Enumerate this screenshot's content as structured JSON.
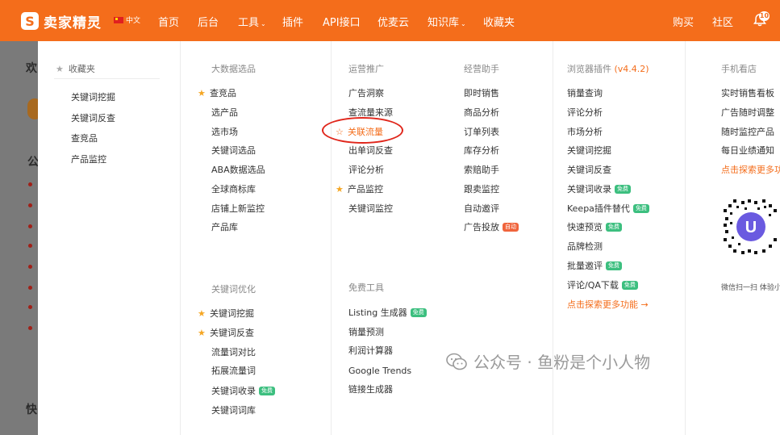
{
  "topbar": {
    "logo_text": "卖家精灵",
    "lang_label": "中文",
    "nav": [
      {
        "label": "首页",
        "caret": false
      },
      {
        "label": "后台",
        "caret": false
      },
      {
        "label": "工具",
        "caret": true
      },
      {
        "label": "插件",
        "caret": false
      },
      {
        "label": "API接口",
        "caret": false
      },
      {
        "label": "优麦云",
        "caret": false
      },
      {
        "label": "知识库",
        "caret": true
      },
      {
        "label": "收藏夹",
        "caret": false
      }
    ],
    "right": [
      {
        "label": "购买"
      },
      {
        "label": "社区"
      }
    ],
    "notification_count": "10",
    "accent": "#f46d1b"
  },
  "background": {
    "fragments": [
      "欢",
      "公",
      "快"
    ]
  },
  "panel": {
    "favorites": {
      "title": "收藏夹",
      "items": [
        "关键词挖掘",
        "关键词反查",
        "查竞品",
        "产品监控"
      ]
    },
    "big_data": {
      "title": "大数据选品",
      "items": [
        {
          "label": "查竞品",
          "starred": true
        },
        {
          "label": "选产品"
        },
        {
          "label": "选市场"
        },
        {
          "label": "关键词选品"
        },
        {
          "label": "ABA数据选品"
        },
        {
          "label": "全球商标库"
        },
        {
          "label": "店铺上新监控"
        },
        {
          "label": "产品库"
        }
      ]
    },
    "keyword_opt": {
      "title": "关键词优化",
      "items": [
        {
          "label": "关键词挖掘",
          "starred": true
        },
        {
          "label": "关键词反查",
          "starred": true
        },
        {
          "label": "流量词对比"
        },
        {
          "label": "拓展流量词"
        },
        {
          "label": "关键词收录",
          "badge": "免费"
        },
        {
          "label": "关键词词库"
        }
      ]
    },
    "ops": {
      "title": "运营推广",
      "items": [
        {
          "label": "广告洞察"
        },
        {
          "label": "查流量来源"
        },
        {
          "label": "关联流量",
          "outline_star": true
        },
        {
          "label": "出单词反查"
        },
        {
          "label": "评论分析"
        },
        {
          "label": "产品监控",
          "starred": true
        },
        {
          "label": "关键词监控"
        }
      ]
    },
    "free_tools": {
      "title": "免费工具",
      "items": [
        {
          "label": "Listing 生成器",
          "badge": "免费"
        },
        {
          "label": "销量预测"
        },
        {
          "label": "利润计算器"
        },
        {
          "label": "Google Trends"
        },
        {
          "label": "链接生成器"
        }
      ]
    },
    "assistant": {
      "title": "经营助手",
      "items": [
        {
          "label": "即时销售"
        },
        {
          "label": "商品分析"
        },
        {
          "label": "订单列表"
        },
        {
          "label": "库存分析"
        },
        {
          "label": "索赔助手"
        },
        {
          "label": "跟卖监控"
        },
        {
          "label": "自动邀评"
        },
        {
          "label": "广告投放",
          "badge": "自动"
        }
      ]
    },
    "plugin": {
      "title": "浏览器插件",
      "version": "(v4.4.2)",
      "items": [
        {
          "label": "销量查询"
        },
        {
          "label": "评论分析"
        },
        {
          "label": "市场分析"
        },
        {
          "label": "关键词挖掘"
        },
        {
          "label": "关键词反查"
        },
        {
          "label": "关键词收录",
          "badge": "免费"
        },
        {
          "label": "Keepa插件替代",
          "badge": "免费"
        },
        {
          "label": "快速预览",
          "badge": "免费"
        },
        {
          "label": "品牌检测"
        },
        {
          "label": "批量邀评",
          "badge": "免费"
        },
        {
          "label": "评论/QA下载",
          "badge": "免费"
        }
      ],
      "more": "点击探索更多功能 →"
    },
    "mobile": {
      "title": "手机看店",
      "items": [
        {
          "label": "实时销售看板"
        },
        {
          "label": "广告随时调整"
        },
        {
          "label": "随时监控产品"
        },
        {
          "label": "每日业绩通知"
        }
      ],
      "more": "点击探索更多功",
      "qr_caption": "微信扫一扫 体验小"
    }
  },
  "watermark": "公众号 · 鱼粉是个小人物"
}
